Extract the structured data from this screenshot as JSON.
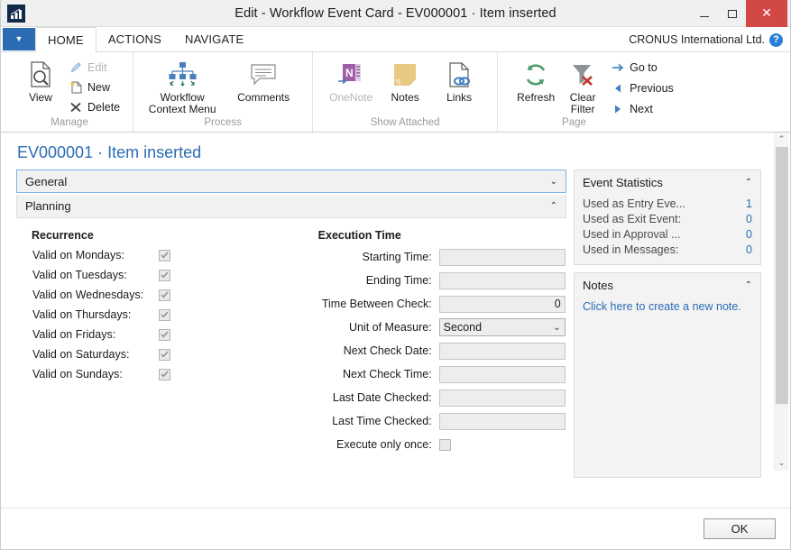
{
  "window": {
    "title": "Edit - Workflow Event Card - EV000001 · Item inserted",
    "app_icon": "bar-chart-icon",
    "minimize_label": "",
    "maximize_label": "",
    "close_label": "✕"
  },
  "ribbon": {
    "quick_access_chevron": "▼",
    "tabs": [
      {
        "label": "HOME",
        "active": true
      },
      {
        "label": "ACTIONS",
        "active": false
      },
      {
        "label": "NAVIGATE",
        "active": false
      }
    ],
    "company": "CRONUS International Ltd.",
    "help_label": "?",
    "groups": [
      {
        "label": "Manage",
        "big": [
          {
            "label": "View",
            "icon": "view-page-magnifier-icon",
            "disabled": false
          }
        ],
        "small": [
          {
            "label": "Edit",
            "icon": "pencil-icon",
            "disabled": true
          },
          {
            "label": "New",
            "icon": "new-page-icon",
            "disabled": false
          },
          {
            "label": "Delete",
            "icon": "delete-x-icon",
            "disabled": false
          }
        ]
      },
      {
        "label": "Process",
        "big": [
          {
            "label": "Workflow Context Menu",
            "icon": "workflow-hierarchy-icon",
            "disabled": false
          },
          {
            "label": "Comments",
            "icon": "comment-balloon-icon",
            "disabled": false
          }
        ],
        "small": []
      },
      {
        "label": "Show Attached",
        "big": [
          {
            "label": "OneNote",
            "icon": "onenote-icon",
            "disabled": true
          },
          {
            "label": "Notes",
            "icon": "sticky-note-icon",
            "disabled": false
          },
          {
            "label": "Links",
            "icon": "links-chain-icon",
            "disabled": false
          }
        ],
        "small": []
      },
      {
        "label": "Page",
        "big": [
          {
            "label": "Refresh",
            "icon": "refresh-circular-arrows-icon",
            "disabled": false
          },
          {
            "label": "Clear Filter",
            "icon": "clear-filter-funnel-icon",
            "disabled": false
          }
        ],
        "small": [
          {
            "label": "Go to",
            "icon": "arrow-right-icon",
            "disabled": false
          },
          {
            "label": "Previous",
            "icon": "arrow-left-triangle-icon",
            "disabled": false
          },
          {
            "label": "Next",
            "icon": "arrow-right-triangle-icon",
            "disabled": false
          }
        ]
      }
    ]
  },
  "page": {
    "title": "EV000001 · Item inserted",
    "sections": [
      {
        "label": "General",
        "expanded": false,
        "chevron": "⌄",
        "focused": true
      },
      {
        "label": "Planning",
        "expanded": true,
        "chevron": "⌃",
        "focused": false
      }
    ],
    "recurrence": {
      "heading": "Recurrence",
      "rows": [
        {
          "label": "Valid on Mondays:",
          "checked": true
        },
        {
          "label": "Valid on Tuesdays:",
          "checked": true
        },
        {
          "label": "Valid on Wednesdays:",
          "checked": true
        },
        {
          "label": "Valid on Thursdays:",
          "checked": true
        },
        {
          "label": "Valid on Fridays:",
          "checked": true
        },
        {
          "label": "Valid on Saturdays:",
          "checked": true
        },
        {
          "label": "Valid on Sundays:",
          "checked": true
        }
      ]
    },
    "execution_time": {
      "heading": "Execution Time",
      "rows": [
        {
          "label": "Starting Time:",
          "value": "",
          "type": "text"
        },
        {
          "label": "Ending Time:",
          "value": "",
          "type": "text"
        },
        {
          "label": "Time Between Check:",
          "value": "0",
          "type": "number"
        },
        {
          "label": "Unit of Measure:",
          "value": "Second",
          "type": "combo",
          "chevron": "⌄"
        },
        {
          "label": "Next Check Date:",
          "value": "",
          "type": "text"
        },
        {
          "label": "Next Check Time:",
          "value": "",
          "type": "text"
        },
        {
          "label": "Last Date Checked:",
          "value": "",
          "type": "text"
        },
        {
          "label": "Last Time Checked:",
          "value": "",
          "type": "text"
        },
        {
          "label": "Execute only once:",
          "value": "",
          "type": "checkbox",
          "checked": false
        }
      ]
    }
  },
  "factboxes": {
    "event_statistics": {
      "title": "Event Statistics",
      "chevron": "⌃",
      "rows": [
        {
          "label": "Used as Entry Eve...",
          "value": "1"
        },
        {
          "label": "Used as Exit Event:",
          "value": "0"
        },
        {
          "label": "Used in Approval ...",
          "value": "0"
        },
        {
          "label": "Used in Messages:",
          "value": "0"
        }
      ]
    },
    "notes": {
      "title": "Notes",
      "chevron": "⌃",
      "link": "Click here to create a new note."
    }
  },
  "scrollbar": {
    "up_arrow": "⌃",
    "down_arrow": "⌄"
  },
  "footer": {
    "ok_label": "OK"
  },
  "colors": {
    "accent_blue": "#2b6cb5",
    "close_red": "#d14844",
    "link_blue": "#2b6cb5",
    "refresh_green": "#4c9a6d"
  }
}
